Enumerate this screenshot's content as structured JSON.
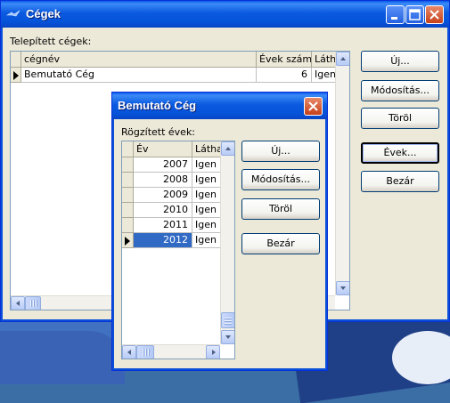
{
  "main_window": {
    "title": "Cégek",
    "installed_label": "Telepített cégek:",
    "columns": [
      "cégnév",
      "Évek száma",
      "Láthat"
    ],
    "rows": [
      {
        "name": "Bemutató Cég",
        "years": "6",
        "visible": "Igen"
      }
    ],
    "buttons": {
      "new": "Új...",
      "modify": "Módosítás...",
      "delete": "Töröl",
      "years": "Évek...",
      "close": "Bezár"
    }
  },
  "dialog": {
    "title": "Bemutató Cég",
    "recorded_label": "Rögzített évek:",
    "columns": [
      "Év",
      "Láthat"
    ],
    "rows": [
      {
        "year": "2007",
        "visible": "Igen"
      },
      {
        "year": "2008",
        "visible": "Igen"
      },
      {
        "year": "2009",
        "visible": "Igen"
      },
      {
        "year": "2010",
        "visible": "Igen"
      },
      {
        "year": "2011",
        "visible": "Igen"
      },
      {
        "year": "2012",
        "visible": "Igen"
      }
    ],
    "selected_year": "2012",
    "buttons": {
      "new": "Új...",
      "modify": "Módosítás...",
      "delete": "Töröl",
      "close": "Bezár"
    }
  },
  "icons": {
    "app": "bird-logo-icon",
    "minimize": "minimize-icon",
    "maximize": "maximize-icon",
    "close": "close-icon"
  },
  "colors": {
    "title_bar": "#0a58e8",
    "selection": "#316ac5",
    "window_bg": "#ece9d8"
  }
}
